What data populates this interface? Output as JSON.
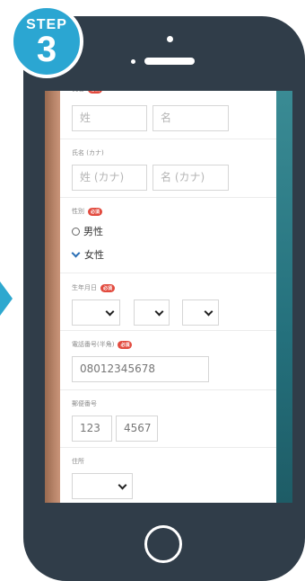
{
  "step": {
    "word": "STEP",
    "number": "3"
  },
  "form": {
    "name": {
      "label": "氏名",
      "required": "必須",
      "last_placeholder": "姓",
      "first_placeholder": "名"
    },
    "name_kana": {
      "label": "氏名 (カナ)",
      "last_placeholder": "姓 (カナ)",
      "first_placeholder": "名 (カナ)"
    },
    "gender": {
      "label": "性別",
      "required": "必須",
      "options": [
        {
          "label": "男性",
          "selected": false
        },
        {
          "label": "女性",
          "selected": true
        }
      ]
    },
    "birthdate": {
      "label": "生年月日",
      "required": "必須"
    },
    "phone": {
      "label": "電話番号(半角)",
      "required": "必須",
      "value": "08012345678"
    },
    "postal": {
      "label": "郵便番号",
      "part1": "123",
      "part2": "4567"
    },
    "address": {
      "label": "住所"
    }
  },
  "colors": {
    "badge": "#2ba6d2",
    "phone_body": "#303d49",
    "required": "#e24b3f",
    "check": "#2a6fb5"
  }
}
